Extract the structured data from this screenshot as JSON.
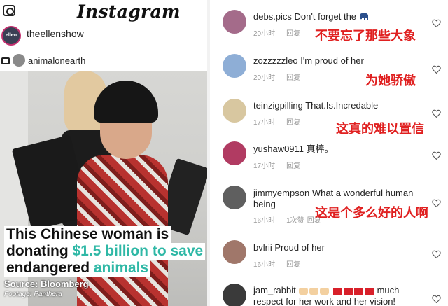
{
  "left": {
    "app_logo": "Instagram",
    "poster_username": "theellenshow",
    "poster_avatar_text": "ellen",
    "reposted_from": "animalonearth",
    "caption": {
      "line1": "This Chinese woman is",
      "line2_prefix": "donating ",
      "line2_accent": "$1.5 billion to save",
      "line3_prefix": "endangered ",
      "line3_accent": "animals"
    },
    "source": "Source: Bloomberg",
    "footage": "Footage: Panthera"
  },
  "comments": [
    {
      "user": "debs.pics",
      "text": "Don't forget the",
      "time": "20小时",
      "reply": "回复",
      "likes": "",
      "translation": "不要忘了那些大象",
      "avatar_color": "#a46b8a",
      "emoji": "elephant"
    },
    {
      "user": "zozzzzzleo",
      "text": "I'm proud of her",
      "time": "20小时",
      "reply": "回复",
      "likes": "",
      "translation": "为她骄傲",
      "avatar_color": "#8eaed6",
      "emoji": ""
    },
    {
      "user": "teinzigpilling",
      "text": "That.Is.Incredable",
      "time": "17小时",
      "reply": "回复",
      "likes": "",
      "translation": "这真的难以置信",
      "avatar_color": "#d8c7a0",
      "emoji": ""
    },
    {
      "user": "yushaw0911",
      "text": "真棒。",
      "time": "17小时",
      "reply": "回复",
      "likes": "",
      "translation": "",
      "avatar_color": "#b13b62",
      "emoji": ""
    },
    {
      "user": "jimmyempson",
      "text": "What a wonderful human being",
      "time": "16小时",
      "reply": "回复",
      "likes": "1次赞",
      "translation": "这是个多么好的人啊",
      "avatar_color": "#5f5f5f",
      "emoji": ""
    },
    {
      "user": "bvlrii",
      "text": "Proud of her",
      "time": "16小时",
      "reply": "回复",
      "likes": "",
      "translation": "",
      "avatar_color": "#a0776a",
      "emoji": ""
    },
    {
      "user": "jam_rabbit",
      "text_pre": "",
      "text_post": "much respect for her work and her vision!",
      "time": "",
      "reply": "",
      "likes": "",
      "translation": "",
      "avatar_color": "#3a3a3a",
      "emoji": "hands-hearts"
    }
  ],
  "colors": {
    "accent": "#2fb8a6",
    "translation_red": "#e02020",
    "meta_gray": "#999999"
  }
}
